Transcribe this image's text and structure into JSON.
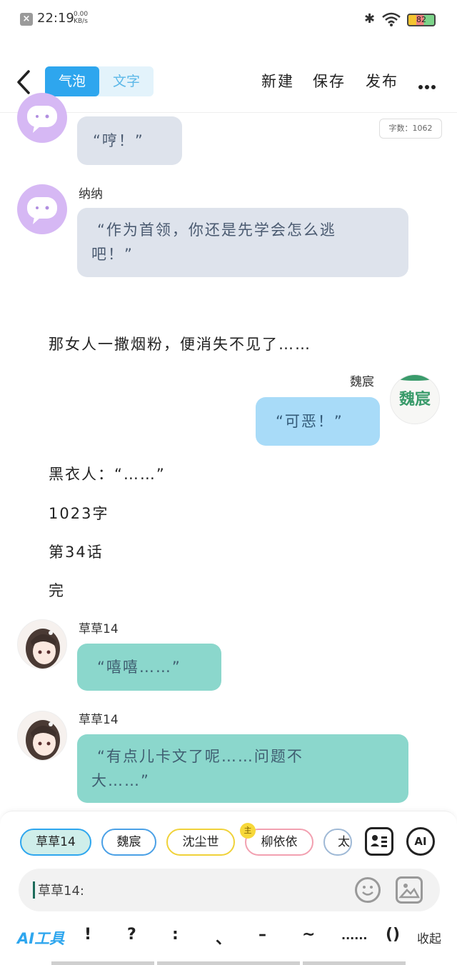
{
  "status_bar": {
    "time": "22:19",
    "net_speed": "0.00",
    "net_unit": "KB/s",
    "battery": "82"
  },
  "header": {
    "tab_bubble": "气泡",
    "tab_text": "文字",
    "new_label": "新建",
    "save_label": "保存",
    "publish_label": "发布"
  },
  "word_count": "字数：1062",
  "messages": [
    {
      "speaker": "",
      "text": "“哼！”"
    },
    {
      "speaker": "纳纳",
      "text": "“作为首领，你还是先学会怎么逃吧！”"
    },
    {
      "narration": "那女人一撒烟粉，便消失不见了……"
    },
    {
      "speaker": "魏宸",
      "text": "“可恶！”",
      "avatar_text": "魏宸"
    },
    {
      "narration": "黑衣人：“……”"
    },
    {
      "narration": "1023字"
    },
    {
      "narration": "第34话"
    },
    {
      "narration": "完"
    },
    {
      "speaker": "草草14",
      "text": "“嘻嘻……”"
    },
    {
      "speaker": "草草14",
      "text": "“有点儿卡文了呢……问题不大……”"
    }
  ],
  "bubble_lines": {
    "m1_line1": "“作为首领，你还是先学会怎么逃",
    "m1_line2": "吧！”",
    "m9_line1": "“有点儿卡文了呢……问题不",
    "m9_line2": "大……”"
  },
  "character_chips": [
    "草草14",
    "魏宸",
    "沈尘世",
    "柳依依",
    "太"
  ],
  "crown_badge": "主",
  "ai_button": "AI",
  "input": {
    "value": "草草14:"
  },
  "toolbar": {
    "ai_tool": "AI工具",
    "punctuation": [
      "!",
      "?",
      ":",
      "、",
      "–",
      "~",
      "......",
      "()"
    ],
    "collapse": "收起"
  },
  "colors": {
    "accent": "#2ea6ee",
    "bubble_gray": "#dee3ec",
    "bubble_blue": "#a8dbf8",
    "bubble_teal": "#8bd7cc",
    "avatar_purple": "#d6b8f4"
  }
}
